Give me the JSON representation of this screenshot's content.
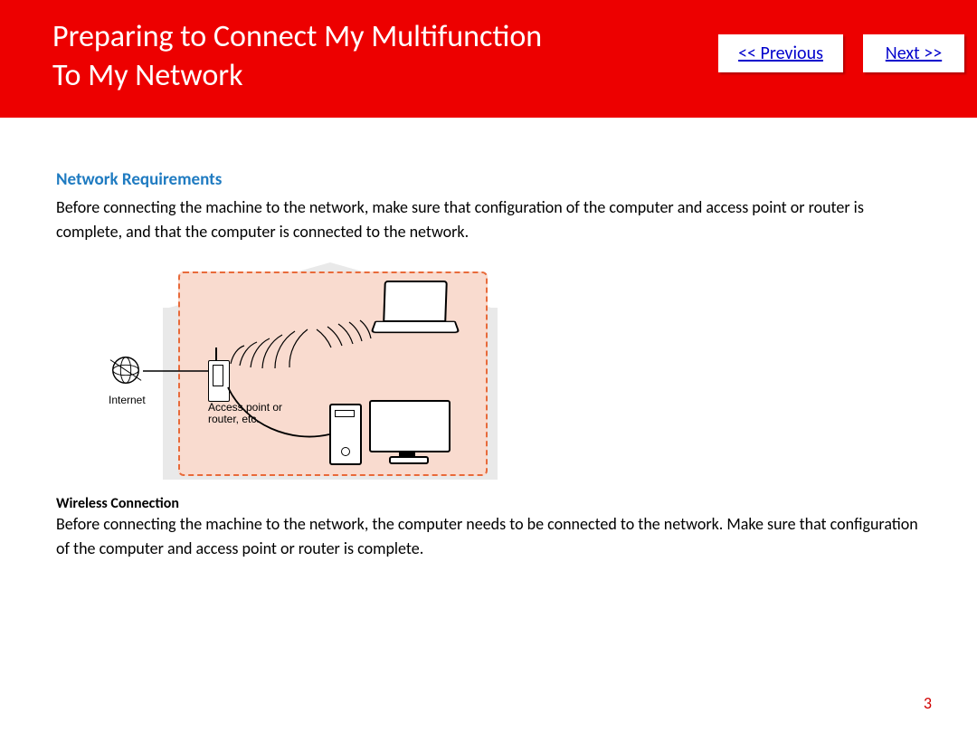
{
  "header": {
    "title": "Preparing to Connect My Multifunction\nTo My Network",
    "prev": "<< Previous",
    "next": "Next >>"
  },
  "section": {
    "heading": "Network Requirements",
    "intro": "Before connecting the machine to the network, make sure that configuration of the computer and access point or router is complete, and that the computer is connected to the network."
  },
  "diagram": {
    "internet_label": "Internet",
    "access_point_label": "Access point or\nrouter, etc."
  },
  "wireless": {
    "heading": "Wireless Connection",
    "body": "Before connecting the machine to the network, the computer needs to be connected to the network. Make sure that configuration of the computer and access point or router is complete."
  },
  "page_number": "3"
}
